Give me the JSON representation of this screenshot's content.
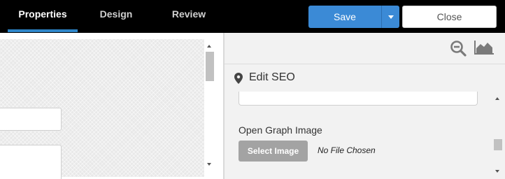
{
  "tabs": [
    {
      "label": "Properties",
      "active": true
    },
    {
      "label": "Design",
      "active": false
    },
    {
      "label": "Review",
      "active": false
    }
  ],
  "actions": {
    "save_label": "Save",
    "close_label": "Close"
  },
  "right_panel": {
    "toolbar_icons": [
      "zoom-out-icon",
      "area-chart-icon"
    ],
    "section_icon": "map-pin-icon",
    "section_title": "Edit SEO",
    "og_image_label": "Open Graph Image",
    "select_image_label": "Select Image",
    "file_status": "No File Chosen"
  },
  "colors": {
    "accent": "#3b8ad6",
    "tab_underline": "#2e86c9",
    "topbar": "#000000",
    "panel_bg": "#f2f2f2",
    "disabled_button": "#a3a3a3"
  }
}
